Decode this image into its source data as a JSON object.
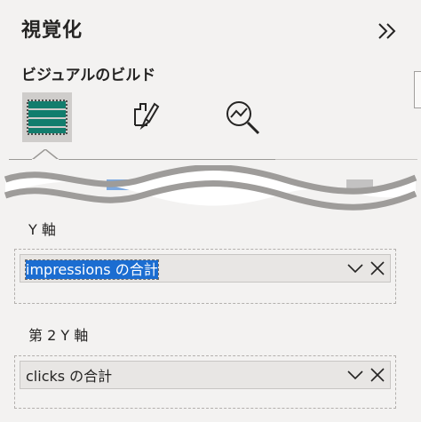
{
  "pane": {
    "title": "視覚化"
  },
  "build": {
    "label": "ビジュアルのビルド"
  },
  "tabs": [
    {
      "name": "build-visual",
      "icon": "table-fields-icon",
      "active": true
    },
    {
      "name": "format-visual",
      "icon": "format-brush-icon",
      "active": false
    },
    {
      "name": "analytics",
      "icon": "analytics-magnifier-icon",
      "active": false
    }
  ],
  "wells": {
    "y_axis": {
      "label": "Y 軸",
      "field": "impressions の合計"
    },
    "secondary_y_axis": {
      "label": "第 2 Y 軸",
      "field": "clicks の合計"
    }
  },
  "colors": {
    "background": "#f3f2f1",
    "accent_green": "#127d6d",
    "selection": "#1b6dd1",
    "wave": "#9e9c9a"
  }
}
